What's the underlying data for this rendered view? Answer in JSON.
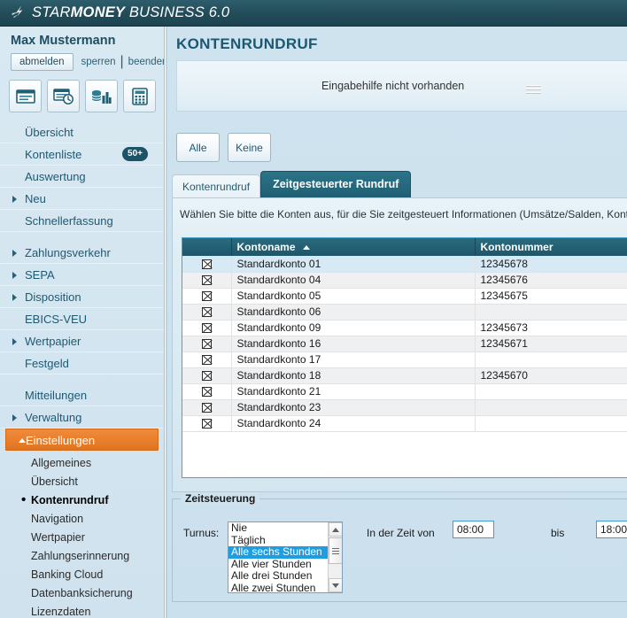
{
  "app": {
    "logo_text_1": "STAR",
    "logo_text_2": "MONEY",
    "logo_text_3": " BUSINESS 6.0",
    "logo_icon": "comet-star-icon"
  },
  "sidebar": {
    "user_name": "Max Mustermann",
    "logout_label": "abmelden",
    "lock_label": "sperren",
    "separator": "|",
    "quit_label": "beenden",
    "toolbar_icons": [
      {
        "name": "account-statement-icon"
      },
      {
        "name": "statement-history-icon"
      },
      {
        "name": "finance-chart-icon"
      },
      {
        "name": "calculator-icon"
      }
    ],
    "nav": [
      {
        "label": "Übersicht",
        "expandable": false,
        "badge": ""
      },
      {
        "label": "Kontenliste",
        "expandable": false,
        "badge": "50+"
      },
      {
        "label": "Auswertung",
        "expandable": false,
        "badge": ""
      },
      {
        "label": "Neu",
        "expandable": true,
        "badge": ""
      },
      {
        "label": "Schnellerfassung",
        "expandable": false,
        "badge": ""
      },
      {
        "label": "Zahlungsverkehr",
        "expandable": true,
        "badge": ""
      },
      {
        "label": "SEPA",
        "expandable": true,
        "badge": ""
      },
      {
        "label": "Disposition",
        "expandable": true,
        "badge": ""
      },
      {
        "label": "EBICS-VEU",
        "expandable": false,
        "badge": ""
      },
      {
        "label": "Wertpapier",
        "expandable": true,
        "badge": ""
      },
      {
        "label": "Festgeld",
        "expandable": false,
        "badge": ""
      },
      {
        "label": "Mitteilungen",
        "expandable": false,
        "badge": ""
      },
      {
        "label": "Verwaltung",
        "expandable": true,
        "badge": ""
      }
    ],
    "active_group": "Einstellungen",
    "sub_items": [
      {
        "label": "Allgemeines",
        "current": false
      },
      {
        "label": "Übersicht",
        "current": false
      },
      {
        "label": "Kontenrundruf",
        "current": true
      },
      {
        "label": "Navigation",
        "current": false
      },
      {
        "label": "Wertpapier",
        "current": false
      },
      {
        "label": "Zahlungserinnerung",
        "current": false
      },
      {
        "label": "Banking Cloud",
        "current": false
      },
      {
        "label": "Datenbanksicherung",
        "current": false
      },
      {
        "label": "Lizenzdaten",
        "current": false
      }
    ]
  },
  "main": {
    "page_title": "KONTENRUNDRUF",
    "help_text": "Eingabehilfe nicht vorhanden",
    "select_all_label": "Alle",
    "select_none_label": "Keine",
    "tabs": [
      {
        "label": "Kontenrundruf",
        "active": false
      },
      {
        "label": "Zeitgesteuerter Rundruf",
        "active": true
      }
    ],
    "panel_note": "Wählen Sie bitte die Konten aus, für die Sie zeitgesteuert Informationen (Umsätze/Salden, Kontoauszüge) ab",
    "table": {
      "columns": [
        "",
        "Kontoname",
        "Kontonummer"
      ],
      "sort_column": "Kontoname",
      "sort_direction": "ascending",
      "rows": [
        {
          "checked": true,
          "name": "Standardkonto 01",
          "number": "12345678"
        },
        {
          "checked": true,
          "name": "Standardkonto 04",
          "number": "12345676"
        },
        {
          "checked": true,
          "name": "Standardkonto 05",
          "number": "12345675"
        },
        {
          "checked": true,
          "name": "Standardkonto 06",
          "number": ""
        },
        {
          "checked": true,
          "name": "Standardkonto 09",
          "number": "12345673"
        },
        {
          "checked": true,
          "name": "Standardkonto 16",
          "number": "12345671"
        },
        {
          "checked": true,
          "name": "Standardkonto 17",
          "number": ""
        },
        {
          "checked": true,
          "name": "Standardkonto 18",
          "number": "12345670"
        },
        {
          "checked": true,
          "name": "Standardkonto 21",
          "number": ""
        },
        {
          "checked": true,
          "name": "Standardkonto 23",
          "number": ""
        },
        {
          "checked": true,
          "name": "Standardkonto 24",
          "number": ""
        }
      ]
    },
    "timing": {
      "legend": "Zeitsteuerung",
      "turnus_label": "Turnus:",
      "turnus_options": [
        {
          "label": "Nie",
          "selected": false
        },
        {
          "label": "Täglich",
          "selected": false
        },
        {
          "label": "Alle sechs Stunden",
          "selected": true
        },
        {
          "label": "Alle vier Stunden",
          "selected": false
        },
        {
          "label": "Alle drei Stunden",
          "selected": false
        },
        {
          "label": "Alle zwei Stunden",
          "selected": false
        }
      ],
      "from_label": "In der Zeit von",
      "from_value": "08:00",
      "to_label": "bis",
      "to_value": "18:00"
    }
  },
  "colors": {
    "header_teal": "#234d5a",
    "accent_orange": "#ea7f2c",
    "tab_active": "#1f5e72",
    "selection_blue": "#1e9de0",
    "title_teal": "#1c5871"
  }
}
